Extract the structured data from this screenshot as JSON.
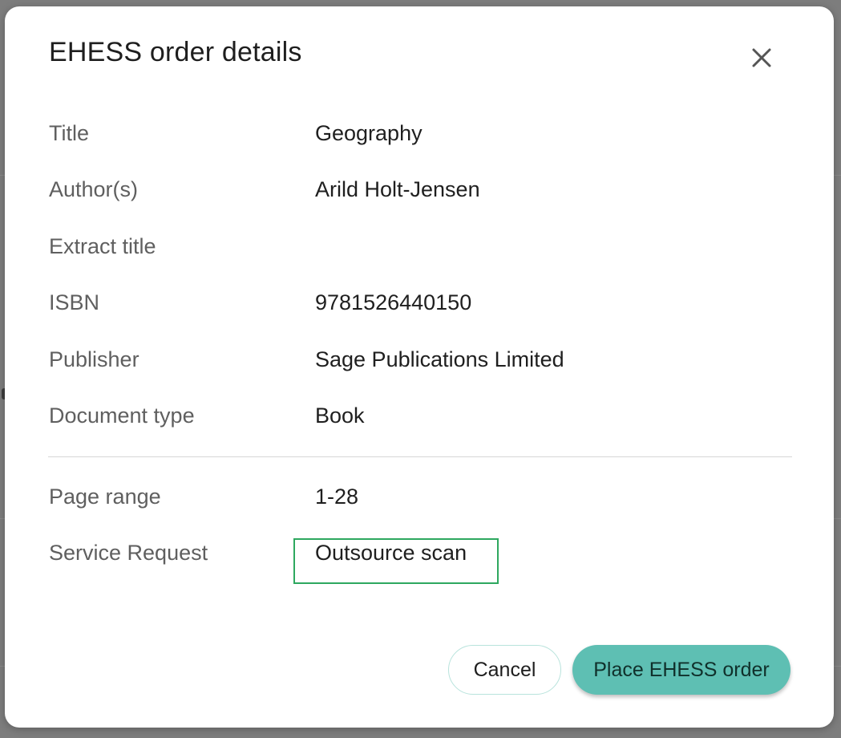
{
  "dialog": {
    "title": "EHESS order details",
    "close_icon": "close-icon"
  },
  "fields": [
    {
      "label": "Title",
      "value": "Geography"
    },
    {
      "label": "Author(s)",
      "value": "Arild Holt-Jensen"
    },
    {
      "label": "Extract title",
      "value": ""
    },
    {
      "label": "ISBN",
      "value": "9781526440150"
    },
    {
      "label": "Publisher",
      "value": "Sage Publications Limited"
    },
    {
      "label": "Document type",
      "value": "Book"
    }
  ],
  "request_fields": [
    {
      "label": "Page range",
      "value": "1-28"
    },
    {
      "label": "Service Request",
      "value": "Outsource scan"
    }
  ],
  "buttons": {
    "cancel_label": "Cancel",
    "place_order_label": "Place EHESS order"
  },
  "colors": {
    "primary": "#5ebfb3",
    "cancel_border": "#b8e3dc",
    "highlight": "#2ea85f",
    "overlay": "#7d7d7d"
  }
}
